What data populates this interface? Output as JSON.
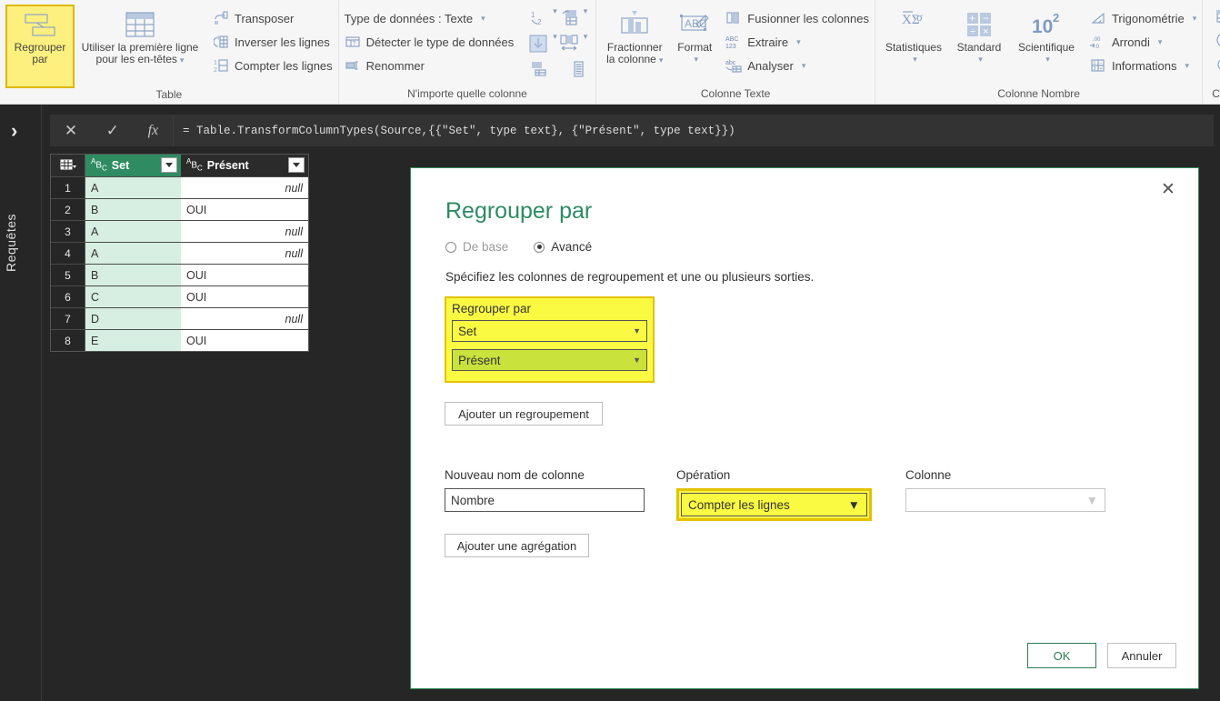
{
  "ribbon": {
    "groups": [
      {
        "title": "Table",
        "big_selected": {
          "label1": "Regrouper",
          "label2": "par",
          "icon": "group-by-icon"
        },
        "big": [
          {
            "label1": "Utiliser la première ligne",
            "label2": "pour les en-têtes",
            "icon": "use-first-row-headers-icon",
            "caret": true
          }
        ],
        "smalls": [
          {
            "label": "Transposer",
            "icon": "transpose-icon"
          },
          {
            "label": "Inverser les lignes",
            "icon": "reverse-rows-icon"
          },
          {
            "label": "Compter les lignes",
            "icon": "count-rows-icon"
          }
        ]
      },
      {
        "title": "N'importe quelle colonne",
        "smalls": [
          {
            "label": "Type de données : Texte",
            "icon": "data-type-icon",
            "caret": true
          },
          {
            "label": "Détecter le type de données",
            "icon": "detect-data-type-icon"
          },
          {
            "label": "Renommer",
            "icon": "rename-icon"
          }
        ],
        "icons": [
          {
            "name": "sort-1-2-icon",
            "caret": true
          },
          {
            "name": "replace-values-icon",
            "caret": true
          },
          {
            "name": "fill-down-icon",
            "caret": true
          },
          {
            "name": "unpivot-columns-icon",
            "caret": true
          },
          {
            "name": "move-column-icon",
            "caret": false
          },
          {
            "name": "convert-to-list-icon",
            "caret": false
          }
        ]
      },
      {
        "title": "Colonne Texte",
        "big": [
          {
            "label1": "Fractionner",
            "label2": "la colonne",
            "icon": "split-column-icon",
            "caret": true
          },
          {
            "label1": "Format",
            "label2": "",
            "icon": "format-abc-icon",
            "caret": true
          }
        ],
        "smalls": [
          {
            "label": "Fusionner les colonnes",
            "icon": "merge-columns-icon"
          },
          {
            "label": "Extraire",
            "icon": "extract-icon",
            "caret": true
          },
          {
            "label": "Analyser",
            "icon": "parse-icon",
            "caret": true
          }
        ]
      },
      {
        "title": "Colonne Nombre",
        "big": [
          {
            "label1": "Statistiques",
            "label2": "",
            "icon": "statistics-icon",
            "caret": true
          },
          {
            "label1": "Standard",
            "label2": "",
            "icon": "standard-icon",
            "caret": true
          },
          {
            "label1": "Scientifique",
            "label2": "",
            "icon": "scientific-icon",
            "caret": true
          }
        ],
        "smalls": [
          {
            "label": "Trigonométrie",
            "icon": "trigonometry-icon",
            "caret": true
          },
          {
            "label": "Arrondi",
            "icon": "rounding-icon",
            "caret": true
          },
          {
            "label": "Informations",
            "icon": "information-icon",
            "caret": true
          }
        ]
      },
      {
        "title": "Colonne",
        "icons": [
          {
            "name": "date-icon",
            "caret": false
          },
          {
            "name": "time-icon",
            "caret": false
          },
          {
            "name": "duration-icon",
            "caret": false
          }
        ]
      }
    ]
  },
  "left_rail": {
    "expand_icon": "chevron-right-icon",
    "label": "Requêtes"
  },
  "formula_bar": {
    "cancel_icon": "cancel-x-icon",
    "accept_icon": "accept-check-icon",
    "fx_icon": "fx-icon",
    "formula": "= Table.TransformColumnTypes(Source,{{\"Set\", type text}, {\"Présent\", type text}})"
  },
  "grid": {
    "corner_icon": "select-all-table-icon",
    "columns": [
      {
        "name": "Set",
        "type_badge": "ABC",
        "selected": true
      },
      {
        "name": "Présent",
        "type_badge": "ABC",
        "selected": false
      }
    ],
    "rows": [
      {
        "n": "1",
        "set": "A",
        "present": "null",
        "is_null": true
      },
      {
        "n": "2",
        "set": "B",
        "present": "OUI",
        "is_null": false
      },
      {
        "n": "3",
        "set": "A",
        "present": "null",
        "is_null": true
      },
      {
        "n": "4",
        "set": "A",
        "present": "null",
        "is_null": true
      },
      {
        "n": "5",
        "set": "B",
        "present": "OUI",
        "is_null": false
      },
      {
        "n": "6",
        "set": "C",
        "present": "OUI",
        "is_null": false
      },
      {
        "n": "7",
        "set": "D",
        "present": "null",
        "is_null": true
      },
      {
        "n": "8",
        "set": "E",
        "present": "OUI",
        "is_null": false
      }
    ]
  },
  "dialog": {
    "close_icon": "close-icon",
    "title": "Regrouper par",
    "mode_basic": "De base",
    "mode_advanced": "Avancé",
    "description": "Spécifiez les colonnes de regroupement et une ou plusieurs sorties.",
    "group_box_label": "Regrouper par",
    "group_column_1": "Set",
    "group_column_2": "Présent",
    "add_grouping_label": "Ajouter un regroupement",
    "new_column_label": "Nouveau nom de colonne",
    "new_column_value": "Nombre",
    "operation_label": "Opération",
    "operation_value": "Compter les lignes",
    "column_label": "Colonne",
    "column_value": "",
    "add_aggregation_label": "Ajouter une agrégation",
    "ok_label": "OK",
    "cancel_label": "Annuler"
  },
  "colors": {
    "accent_green": "#2e8b62",
    "highlight_yellow": "#fafa43",
    "highlight_border": "#e3c200",
    "highlight_green": "#c9e23c",
    "selected_column": "#d7efe2"
  }
}
